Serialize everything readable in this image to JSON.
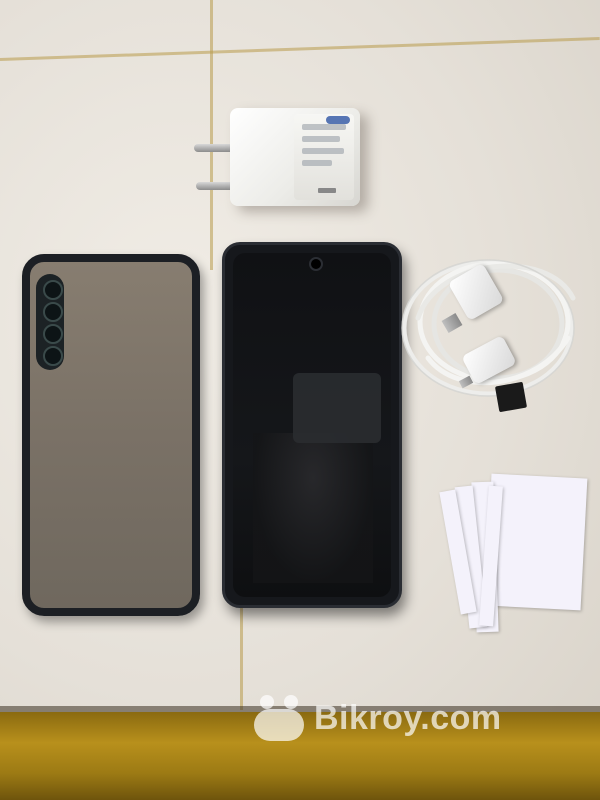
{
  "scene": {
    "description_items": [
      "wall-charger",
      "phone-case",
      "smartphone",
      "usb-cable",
      "micro-sd-card",
      "paper-manuals"
    ]
  },
  "watermark": {
    "text": "Bikroy.com"
  },
  "colors": {
    "floor": "#e8e3dc",
    "tile_grout": "#b89a4a",
    "yellow_floor": "#b8901c",
    "phone_body": "#16181c",
    "case_frame": "#1c1f24",
    "charger": "#f4f4f1"
  }
}
